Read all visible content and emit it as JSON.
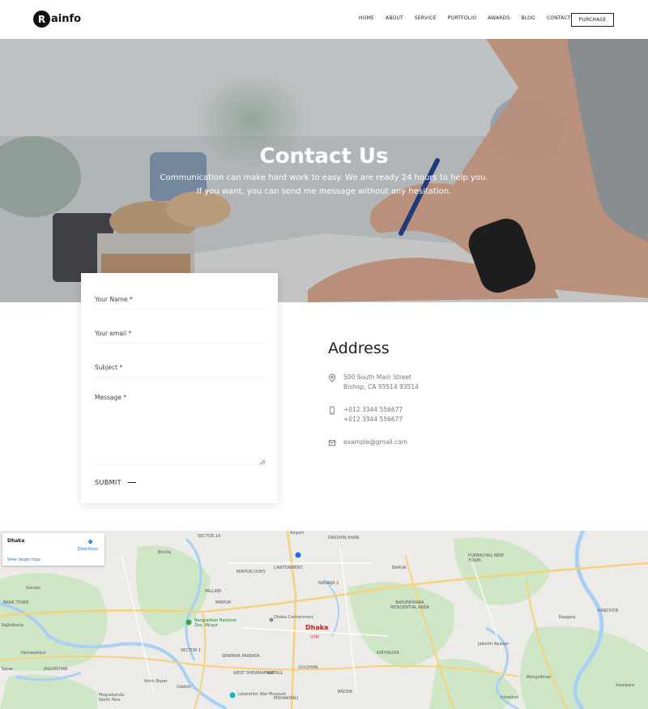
{
  "brand": {
    "logo_letter": "R",
    "logo_text": "ainfo"
  },
  "nav": {
    "items": [
      "HOME",
      "ABOUT",
      "SERVICE",
      "PORTFOLIO",
      "AWARDS",
      "BLOG",
      "CONTACT"
    ],
    "purchase_label": "PURCHASE"
  },
  "hero": {
    "title": "Contact Us",
    "subtitle": "Communication can make hard work to easy. We are ready 24 hours to help you. If you want, you can send me message without any hesitation."
  },
  "form": {
    "name_placeholder": "Your Name *",
    "email_placeholder": "Your email *",
    "subject_placeholder": "Subject *",
    "message_placeholder": "Message *",
    "submit_label": "SUBMIT"
  },
  "address": {
    "title": "Address",
    "location": [
      "500 South Main Street",
      "Bishop, CA 93514 93514"
    ],
    "phones": [
      "+012 3344 556677",
      "+012 3344 556677"
    ],
    "email": "example@gmail.com",
    "icons": [
      "map-pin-icon",
      "phone-icon",
      "mail-icon"
    ]
  },
  "map": {
    "place": "Dhaka",
    "directions_label": "Directions",
    "larger_map_label": "View larger map",
    "city_label": "Dhaka",
    "city_label_local": "ঢাকা",
    "labels": [
      "SECTOR 14",
      "Airport",
      "DAKSHIN KHAN",
      "Birulia",
      "MIRPUR DOHS",
      "CANTONMENT",
      "BARUA",
      "PALLABI",
      "MIRPUR",
      "Gendai",
      "NIKUNJA 2",
      "Bangladesh National Zoo, Mirpur",
      "Dhaka Cantonment",
      "BASUNDHARA RESIDENTIAL AREA",
      "Rupganj",
      "KANCHON",
      "Hemayetpur",
      "SECTOR 1",
      "KATHALDIA",
      "Jaleshri Abason",
      "Savar",
      "JAGURCHAR",
      "GULSHAN",
      "Mongolkhali",
      "BADDA",
      "Liberation War Museum",
      "Mograkanda North Para",
      "Ichakhali",
      "PURBACHAL NEW TOWN",
      "BANK TOWN",
      "Rajfulbaria",
      "SENPARA PARBATA",
      "Gabtoli",
      "Amin Bazar",
      "WEST SHEWRAPARA",
      "KAFRUL",
      "MOHAKHALI",
      "Swalpara"
    ]
  },
  "colors": {
    "accent": "#111111",
    "map_water": "#a8d0f5",
    "map_green": "#cde8c4",
    "map_road": "#f4d27a",
    "link": "#1a73e8"
  }
}
